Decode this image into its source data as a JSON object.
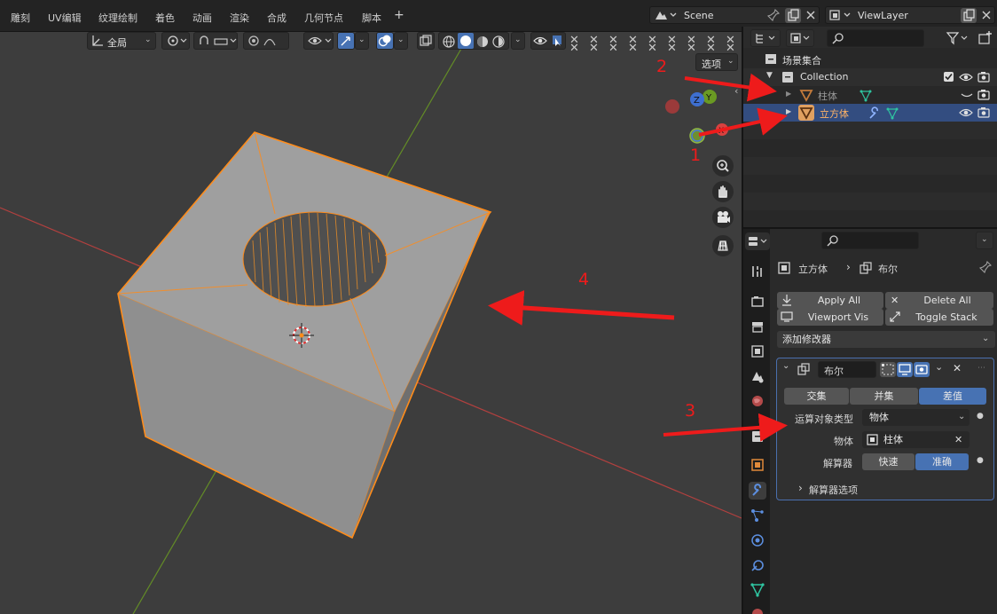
{
  "menu": {
    "items": [
      "雕刻",
      "UV编辑",
      "纹理绘制",
      "着色",
      "动画",
      "渲染",
      "合成",
      "几何节点",
      "脚本"
    ],
    "add_tab": "+"
  },
  "scene": {
    "label": "Scene"
  },
  "viewlayer": {
    "label": "ViewLayer"
  },
  "viewport": {
    "orientation": "全局",
    "options_label": "选项",
    "gizmo": {
      "x": "X",
      "y": "Y",
      "z": "Z"
    }
  },
  "outliner": {
    "root": "场景集合",
    "collection": "Collection",
    "objects": [
      {
        "name": "柱体",
        "selected": false
      },
      {
        "name": "立方体",
        "selected": true
      }
    ]
  },
  "properties": {
    "breadcrumb": {
      "object": "立方体",
      "modifier": "布尔"
    },
    "apply_all": "Apply All",
    "delete_all": "Delete All",
    "viewport_vis": "Viewport Vis",
    "toggle_stack": "Toggle Stack",
    "add_modifier": "添加修改器",
    "modifier": {
      "name": "布尔",
      "operations": [
        "交集",
        "并集",
        "差值"
      ],
      "active_operation": "差值",
      "operand_type_label": "运算对象类型",
      "operand_type_value": "物体",
      "object_label": "物体",
      "object_value": "柱体",
      "solver_label": "解算器",
      "solvers": [
        "快速",
        "准确"
      ],
      "active_solver": "准确",
      "solver_options": "解算器选项"
    }
  },
  "annotations": [
    "1",
    "2",
    "3",
    "4"
  ],
  "colors": {
    "accent": "#4772b3",
    "selection_outline": "#ff8c1a",
    "annotation": "#ee1b1b",
    "x_axis": "#d9413f",
    "y_axis": "#6a9a23"
  }
}
